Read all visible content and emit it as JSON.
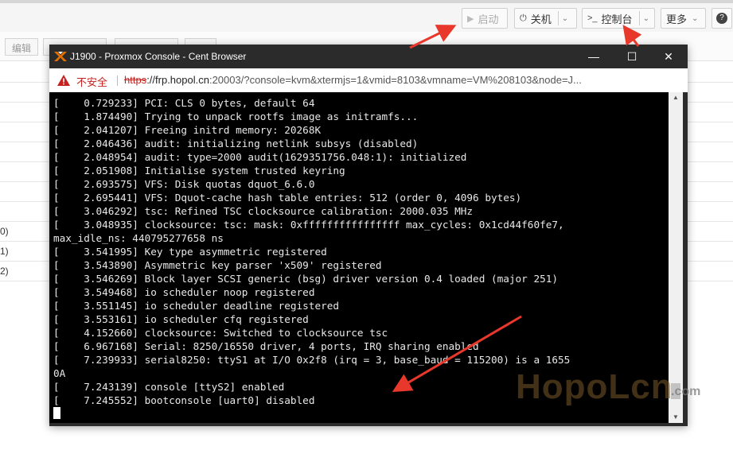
{
  "page": {
    "top_buttons": [
      {
        "label": "启动",
        "icon": "play-icon",
        "disabled": true
      },
      {
        "label": "关机",
        "icon": "power-icon",
        "disabled": false
      },
      {
        "label": "控制台",
        "icon": "terminal-prompt-icon",
        "disabled": false
      },
      {
        "label": "更多",
        "icon": "chevron-down-icon",
        "disabled": false
      },
      {
        "label": "",
        "icon": "help-icon",
        "disabled": false
      }
    ],
    "toolbar_buttons": [
      {
        "label": "编辑"
      }
    ],
    "row_fragments": [
      "0)",
      "1)",
      "2)"
    ]
  },
  "window": {
    "title": "J1900 - Proxmox Console - Cent Browser",
    "controls": {
      "minimize": "—",
      "maximize": "☐",
      "close": "✕"
    },
    "address": {
      "security_label": "不安全",
      "scheme": "https",
      "host": "://frp.hopol.cn",
      "path": ":20003/?console=kvm&xtermjs=1&vmid=8103&vmname=VM%208103&node=J..."
    }
  },
  "terminal": {
    "lines": [
      "[    0.729233] PCI: CLS 0 bytes, default 64",
      "[    1.874490] Trying to unpack rootfs image as initramfs...",
      "[    2.041207] Freeing initrd memory: 20268K",
      "[    2.046436] audit: initializing netlink subsys (disabled)",
      "[    2.048954] audit: type=2000 audit(1629351756.048:1): initialized",
      "[    2.051908] Initialise system trusted keyring",
      "[    2.693575] VFS: Disk quotas dquot_6.6.0",
      "[    2.695441] VFS: Dquot-cache hash table entries: 512 (order 0, 4096 bytes)",
      "[    3.046292] tsc: Refined TSC clocksource calibration: 2000.035 MHz",
      "[    3.048935] clocksource: tsc: mask: 0xffffffffffffffff max_cycles: 0x1cd44f60fe7,",
      "max_idle_ns: 440795277658 ns",
      "[    3.541995] Key type asymmetric registered",
      "[    3.543890] Asymmetric key parser 'x509' registered",
      "[    3.546269] Block layer SCSI generic (bsg) driver version 0.4 loaded (major 251)",
      "[    3.549468] io scheduler noop registered",
      "[    3.551145] io scheduler deadline registered",
      "[    3.553161] io scheduler cfq registered",
      "[    4.152660] clocksource: Switched to clocksource tsc",
      "[    6.967168] Serial: 8250/16550 driver, 4 ports, IRQ sharing enabled",
      "[    7.239933] serial8250: ttyS1 at I/O 0x2f8 (irq = 3, base_baud = 115200) is a 1655",
      "0A",
      "[    7.243139] console [ttyS2] enabled",
      "[    7.245552] bootconsole [uart0] disabled"
    ]
  },
  "watermark": {
    "main": "HopoLcn",
    "suffix": ".com"
  },
  "colors": {
    "terminal_bg": "#000000",
    "terminal_fg": "#e8e8e8",
    "chrome": "#2b2b2b",
    "arrow": "#e8382b",
    "insecure": "#c5221f"
  }
}
